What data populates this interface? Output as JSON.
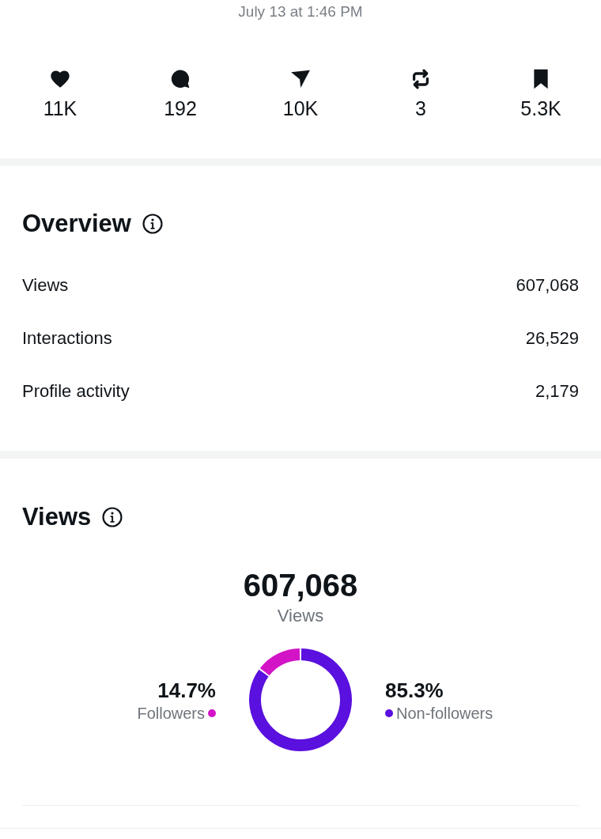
{
  "timestamp": "July 13 at 1:46 PM",
  "engagement": [
    {
      "kind": "like",
      "count": "11K"
    },
    {
      "kind": "reply",
      "count": "192"
    },
    {
      "kind": "share",
      "count": "10K"
    },
    {
      "kind": "repost",
      "count": "3"
    },
    {
      "kind": "bookmark",
      "count": "5.3K"
    }
  ],
  "overview": {
    "title": "Overview",
    "rows": [
      {
        "label": "Views",
        "value": "607,068"
      },
      {
        "label": "Interactions",
        "value": "26,529"
      },
      {
        "label": "Profile activity",
        "value": "2,179"
      }
    ]
  },
  "views": {
    "title": "Views",
    "total": "607,068",
    "breakdown": [
      {
        "percent": "14.7%",
        "color": "#d214c6"
      },
      {
        "percent": "85.3%",
        "color": "#5a10de"
      }
    ],
    "chart_data": {
      "type": "donut",
      "categories": [
        "Followers",
        "Non-followers"
      ],
      "series": [
        {
          "name": "Views",
          "values": [
            14.7,
            85.3
          ]
        }
      ]
    }
  }
}
